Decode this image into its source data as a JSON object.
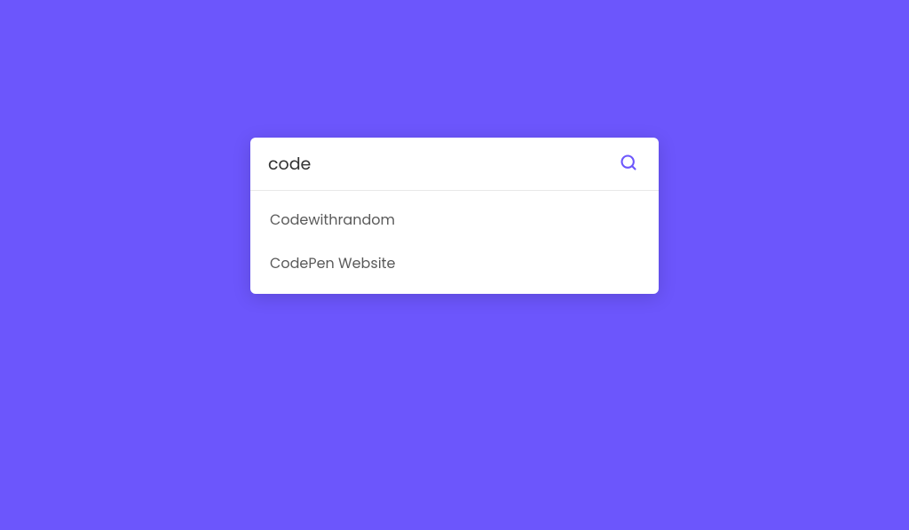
{
  "search": {
    "value": "code",
    "placeholder": "",
    "icon_color": "#6c56fc"
  },
  "suggestions": [
    "Codewithrandom",
    "CodePen Website"
  ]
}
